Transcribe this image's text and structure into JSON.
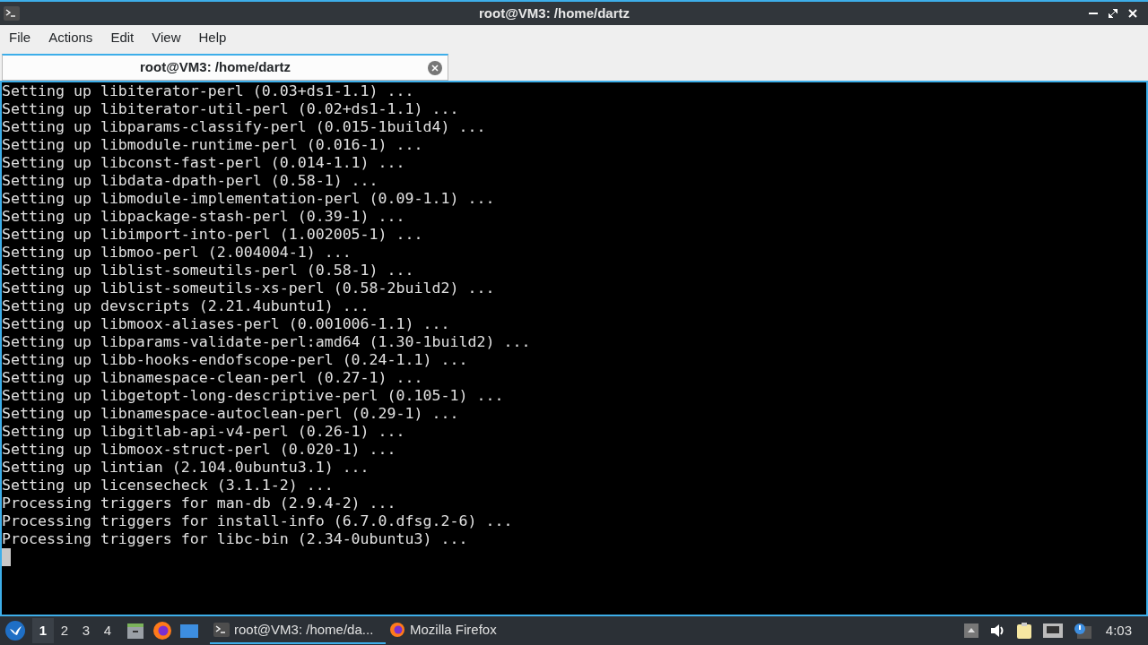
{
  "window": {
    "title": "root@VM3: /home/dartz"
  },
  "menu": [
    "File",
    "Actions",
    "Edit",
    "View",
    "Help"
  ],
  "tabs": [
    {
      "label": "root@VM3: /home/dartz",
      "selected": true
    }
  ],
  "terminal": {
    "lines": [
      "Setting up libiterator-perl (0.03+ds1-1.1) ...",
      "Setting up libiterator-util-perl (0.02+ds1-1.1) ...",
      "Setting up libparams-classify-perl (0.015-1build4) ...",
      "Setting up libmodule-runtime-perl (0.016-1) ...",
      "Setting up libconst-fast-perl (0.014-1.1) ...",
      "Setting up libdata-dpath-perl (0.58-1) ...",
      "Setting up libmodule-implementation-perl (0.09-1.1) ...",
      "Setting up libpackage-stash-perl (0.39-1) ...",
      "Setting up libimport-into-perl (1.002005-1) ...",
      "Setting up libmoo-perl (2.004004-1) ...",
      "Setting up liblist-someutils-perl (0.58-1) ...",
      "Setting up liblist-someutils-xs-perl (0.58-2build2) ...",
      "Setting up devscripts (2.21.4ubuntu1) ...",
      "Setting up libmoox-aliases-perl (0.001006-1.1) ...",
      "Setting up libparams-validate-perl:amd64 (1.30-1build2) ...",
      "Setting up libb-hooks-endofscope-perl (0.24-1.1) ...",
      "Setting up libnamespace-clean-perl (0.27-1) ...",
      "Setting up libgetopt-long-descriptive-perl (0.105-1) ...",
      "Setting up libnamespace-autoclean-perl (0.29-1) ...",
      "Setting up libgitlab-api-v4-perl (0.26-1) ...",
      "Setting up libmoox-struct-perl (0.020-1) ...",
      "Setting up lintian (2.104.0ubuntu3.1) ...",
      "Setting up licensecheck (3.1.1-2) ...",
      "Processing triggers for man-db (2.9.4-2) ...",
      "Processing triggers for install-info (6.7.0.dfsg.2-6) ...",
      "Processing triggers for libc-bin (2.34-0ubuntu3) ..."
    ]
  },
  "taskbar": {
    "workspaces": [
      {
        "label": "1",
        "selected": true
      },
      {
        "label": "2",
        "selected": false
      },
      {
        "label": "3",
        "selected": false
      },
      {
        "label": "4",
        "selected": false
      }
    ],
    "tasks": [
      {
        "kind": "terminal",
        "label": "root@VM3: /home/da...",
        "selected": true
      },
      {
        "kind": "firefox",
        "label": "Mozilla Firefox",
        "selected": false
      }
    ],
    "clock": "4:03"
  }
}
